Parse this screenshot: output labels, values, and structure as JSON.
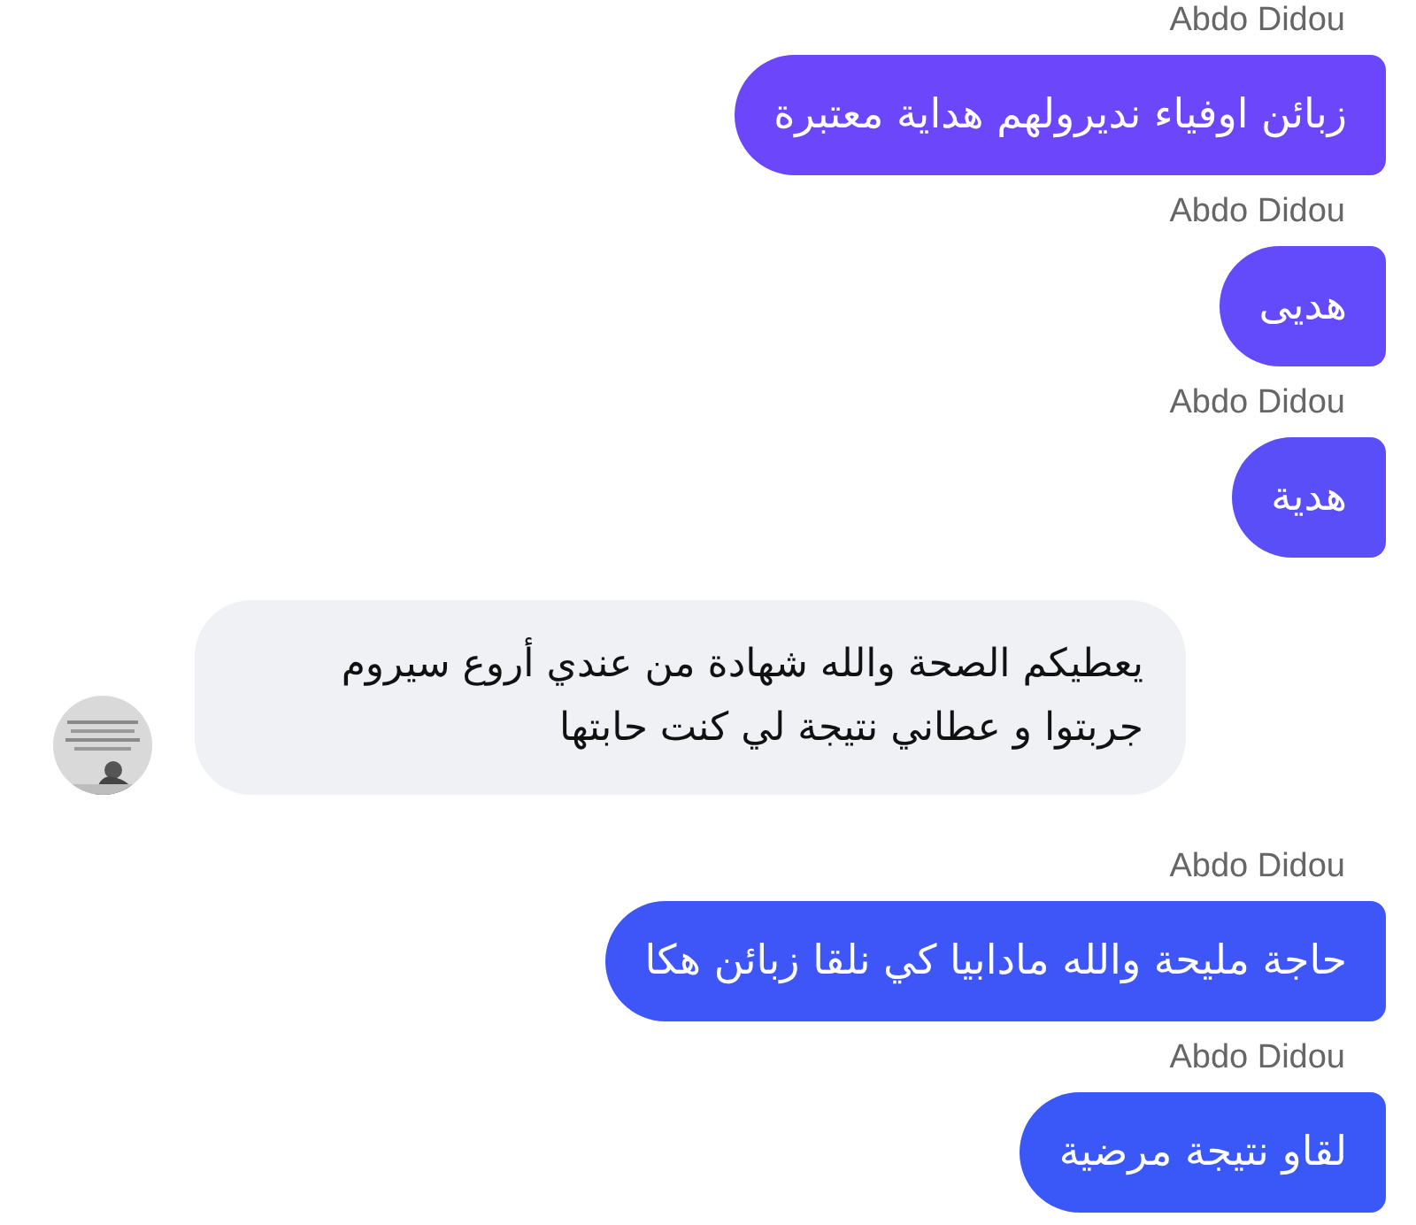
{
  "messages": [
    {
      "kind": "outgoing",
      "sender": "Abdo Didou",
      "text": "زبائن اوفياء نديرولهم هداية معتبرة",
      "color": "#6b46fb"
    },
    {
      "kind": "outgoing",
      "sender": "Abdo Didou",
      "text": "هديى",
      "color": "#634afa"
    },
    {
      "kind": "outgoing",
      "sender": "Abdo Didou",
      "text": "هدية",
      "color": "#5a4ef9"
    },
    {
      "kind": "incoming",
      "text": "يعطيكم الصحة والله شهادة من عندي أروع سيروم جربتوا  و عطاني نتيجة لي كنت حابتها"
    },
    {
      "kind": "outgoing",
      "sender": "Abdo Didou",
      "text": "حاجة مليحة والله مادابيا كي نلقا زبائن هكا",
      "color": "#3e56f8"
    },
    {
      "kind": "outgoing",
      "sender": "Abdo Didou",
      "text": "لقاو نتيجة مرضية",
      "color": "#3a58f7"
    }
  ]
}
